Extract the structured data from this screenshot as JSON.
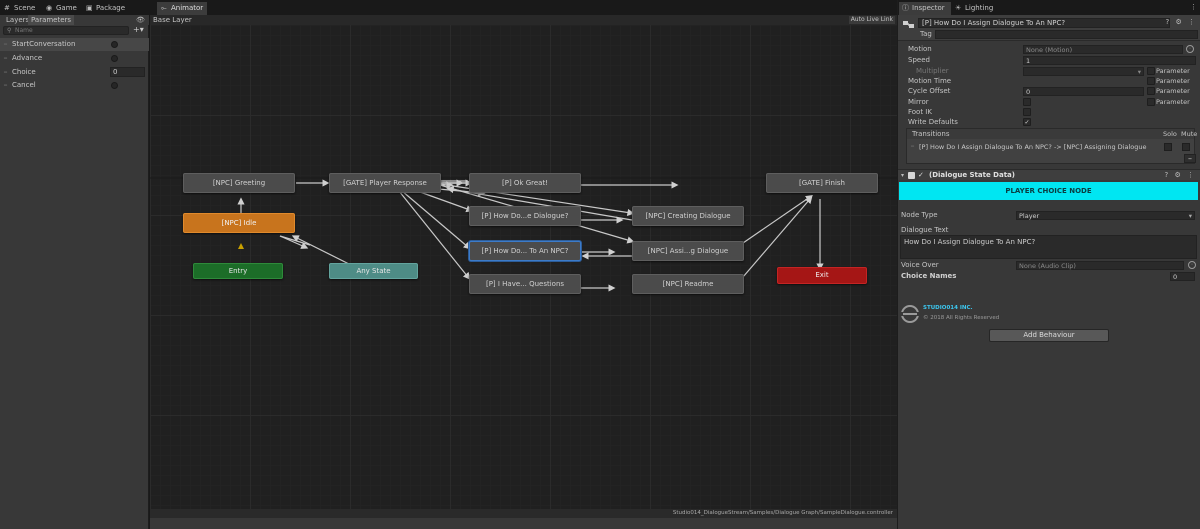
{
  "top_tabs": [
    {
      "label": "Scene",
      "icon": "hash-icon"
    },
    {
      "label": "Game",
      "icon": "gamepad-icon"
    },
    {
      "label": "Package Manager",
      "icon": "package-icon"
    },
    {
      "label": "Animator",
      "icon": "animator-icon"
    }
  ],
  "parameters_panel": {
    "tabs": [
      "Layers",
      "Parameters"
    ],
    "search_placeholder": "Name",
    "params": [
      {
        "name": "StartConversation",
        "type": "trigger",
        "value": ""
      },
      {
        "name": "Advance",
        "type": "trigger",
        "value": ""
      },
      {
        "name": "Choice",
        "type": "int",
        "value": "0"
      },
      {
        "name": "Cancel",
        "type": "trigger",
        "value": ""
      }
    ]
  },
  "graph": {
    "layer_label": "Base Layer",
    "auto_live_link": "Auto Live Link",
    "path": "Studio014_DialogueStream/Samples/Dialogue Graph/SampleDialogue.controller",
    "nodes": {
      "greeting": "[NPC] Greeting",
      "idle": "[NPC] Idle",
      "entry": "Entry",
      "any_state": "Any State",
      "player_response": "[GATE] Player Response",
      "ok_great": "[P] Ok Great!",
      "how_do_dialogue": "[P] How Do...e Dialogue?",
      "how_do_npc": "[P] How Do... To An NPC?",
      "i_have_questions": "[P] I Have... Questions",
      "creating_dialogue": "[NPC] Creating Dialogue",
      "assigning_dialogue": "[NPC] Assi...g Dialogue",
      "readme": "[NPC] Readme",
      "finish": "[GATE] Finish",
      "exit": "Exit"
    },
    "colors": {
      "wire": "#c8c8c8",
      "entry_arrow": "#c8a000"
    }
  },
  "inspector": {
    "tabs": [
      {
        "label": "Inspector",
        "icon": "info-icon"
      },
      {
        "label": "Lighting",
        "icon": "lightbulb-icon"
      }
    ],
    "state_name": "[P] How Do I Assign Dialogue To An NPC?",
    "tag_label": "Tag",
    "tag_value": "",
    "props": {
      "motion": {
        "label": "Motion",
        "value": "None (Motion)"
      },
      "speed": {
        "label": "Speed",
        "value": "1"
      },
      "multiplier": {
        "label": "Multiplier",
        "param_label": "Parameter"
      },
      "motion_time": {
        "label": "Motion Time",
        "param_label": "Parameter"
      },
      "cycle_offset": {
        "label": "Cycle Offset",
        "value": "0",
        "param_label": "Parameter"
      },
      "mirror": {
        "label": "Mirror",
        "param_label": "Parameter"
      },
      "foot_ik": {
        "label": "Foot IK"
      },
      "write_defaults": {
        "label": "Write Defaults",
        "check": "✓"
      }
    },
    "transitions": {
      "title": "Transitions",
      "solo": "Solo",
      "mute": "Mute",
      "items": [
        "[P] How Do I Assign Dialogue To An NPC? -> [NPC] Assigning Dialogue"
      ],
      "remove_label": "–"
    },
    "component": {
      "title": "(Dialogue State Data)",
      "check": "✓",
      "banner": "PLAYER CHOICE NODE",
      "banner_color": "#00e6f2",
      "node_type_label": "Node Type",
      "node_type_value": "Player",
      "dialogue_text_label": "Dialogue Text",
      "dialogue_text_value": "How Do I Assign Dialogue To An NPC?",
      "voice_over_label": "Voice Over",
      "voice_over_value": "None (Audio Clip)",
      "choice_names_label": "Choice Names",
      "choice_names_count": "0"
    },
    "brand": {
      "name": "STUDIO014 INC.",
      "copyright": "© 2018 All Rights Reserved"
    },
    "add_behaviour": "Add Behaviour"
  }
}
